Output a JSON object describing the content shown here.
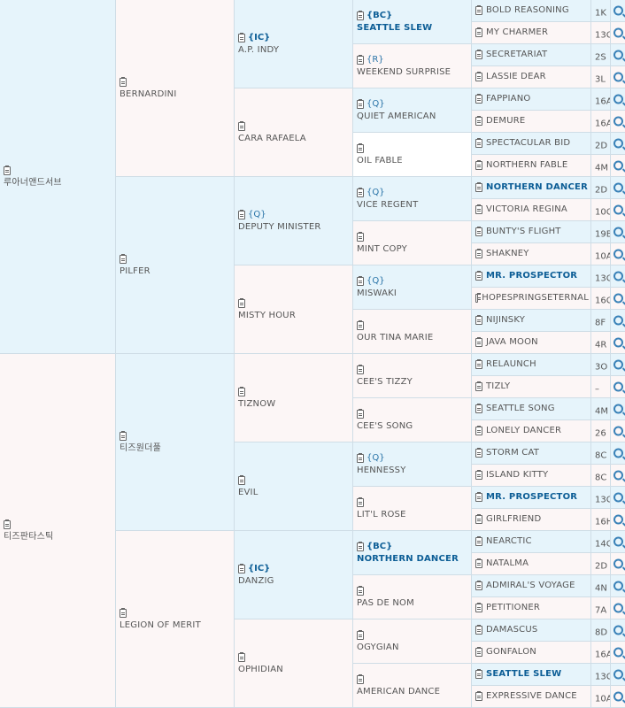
{
  "gen1": [
    {
      "name": "루아너앤드서브"
    },
    {
      "name": "티즈판타스틱"
    }
  ],
  "gen2": [
    {
      "name": "BERNARDINI"
    },
    {
      "name": "PILFER"
    },
    {
      "name": "티즈원더풀"
    },
    {
      "name": "LEGION OF MERIT"
    }
  ],
  "gen3": [
    {
      "badge": "{IC}",
      "name": "A.P. INDY"
    },
    {
      "badge": "",
      "name": "CARA RAFAELA"
    },
    {
      "badge": "{Q}",
      "name": "DEPUTY MINISTER"
    },
    {
      "badge": "",
      "name": "MISTY HOUR"
    },
    {
      "badge": "",
      "name": "TIZNOW"
    },
    {
      "badge": "",
      "name": "EVIL"
    },
    {
      "badge": "{IC}",
      "name": "DANZIG"
    },
    {
      "badge": "",
      "name": "OPHIDIAN"
    }
  ],
  "gen4": [
    {
      "badge": "{BC}",
      "name": "SEATTLE SLEW",
      "highlight": true
    },
    {
      "badge": "{R}",
      "name": "WEEKEND SURPRISE"
    },
    {
      "badge": "{Q}",
      "name": "QUIET AMERICAN"
    },
    {
      "badge": "",
      "name": "OIL FABLE"
    },
    {
      "badge": "{Q}",
      "name": "VICE REGENT"
    },
    {
      "badge": "",
      "name": "MINT COPY"
    },
    {
      "badge": "{Q}",
      "name": "MISWAKI"
    },
    {
      "badge": "",
      "name": "OUR TINA MARIE"
    },
    {
      "badge": "",
      "name": "CEE'S TIZZY"
    },
    {
      "badge": "",
      "name": "CEE'S SONG"
    },
    {
      "badge": "{Q}",
      "name": "HENNESSY"
    },
    {
      "badge": "",
      "name": "LIT'L ROSE"
    },
    {
      "badge": "{BC}",
      "name": "NORTHERN DANCER",
      "highlight": true
    },
    {
      "badge": "",
      "name": "PAS DE NOM"
    },
    {
      "badge": "",
      "name": "OGYGIAN"
    },
    {
      "badge": "",
      "name": "AMERICAN DANCE"
    }
  ],
  "gen5": [
    {
      "name": "BOLD REASONING",
      "code": "1K"
    },
    {
      "name": "MY CHARMER",
      "code": "13C"
    },
    {
      "name": "SECRETARIAT",
      "code": "2S"
    },
    {
      "name": "LASSIE DEAR",
      "code": "3L"
    },
    {
      "name": "FAPPIANO",
      "code": "16A"
    },
    {
      "name": "DEMURE",
      "code": "16A"
    },
    {
      "name": "SPECTACULAR BID",
      "code": "2D"
    },
    {
      "name": "NORTHERN FABLE",
      "code": "4M"
    },
    {
      "name": "NORTHERN DANCER",
      "code": "2D",
      "highlight": true
    },
    {
      "name": "VICTORIA REGINA",
      "code": "10C"
    },
    {
      "name": "BUNTY'S FLIGHT",
      "code": "19B"
    },
    {
      "name": "SHAKNEY",
      "code": "10A"
    },
    {
      "name": "MR. PROSPECTOR",
      "code": "13C",
      "highlight": true
    },
    {
      "name": "HOPESPRINGSETERNAL",
      "code": "16C"
    },
    {
      "name": "NIJINSKY",
      "code": "8F"
    },
    {
      "name": "JAVA MOON",
      "code": "4R"
    },
    {
      "name": "RELAUNCH",
      "code": "3O"
    },
    {
      "name": "TIZLY",
      "code": "–"
    },
    {
      "name": "SEATTLE SONG",
      "code": "4M"
    },
    {
      "name": "LONELY DANCER",
      "code": "26"
    },
    {
      "name": "STORM CAT",
      "code": "8C"
    },
    {
      "name": "ISLAND KITTY",
      "code": "8C"
    },
    {
      "name": "MR. PROSPECTOR",
      "code": "13C",
      "highlight": true
    },
    {
      "name": "GIRLFRIEND",
      "code": "16H"
    },
    {
      "name": "NEARCTIC",
      "code": "14C"
    },
    {
      "name": "NATALMA",
      "code": "2D"
    },
    {
      "name": "ADMIRAL'S VOYAGE",
      "code": "4N"
    },
    {
      "name": "PETITIONER",
      "code": "7A"
    },
    {
      "name": "DAMASCUS",
      "code": "8D"
    },
    {
      "name": "GONFALON",
      "code": "16A"
    },
    {
      "name": "SEATTLE SLEW",
      "code": "13C",
      "highlight": true
    },
    {
      "name": "EXPRESSIVE DANCE",
      "code": "10A"
    }
  ]
}
